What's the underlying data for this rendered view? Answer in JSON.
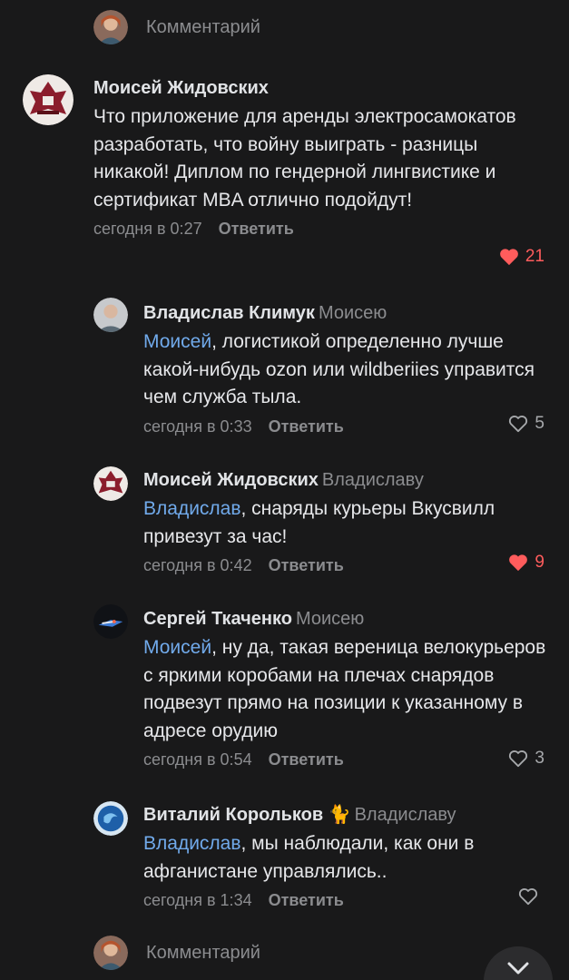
{
  "compose": {
    "placeholder": "Комментарий"
  },
  "comments": [
    {
      "author": "Моисей Жидовских",
      "reply_to": "",
      "mention": "",
      "text": "Что приложение для аренды электросамокатов разработать, что войну выиграть - разницы никакой! Диплом по гендерной лингвистике и сертификат MBA отлично подойдут!",
      "time": "сегодня в 0:27",
      "reply_label": "Ответить",
      "likes": "21",
      "liked": true
    },
    {
      "author": "Владислав Климук",
      "reply_to": "Моисею",
      "mention": "Моисей",
      "text": ", логистикой определенно лучше какой-нибудь ozon или wildberiies управится чем служба тыла.",
      "time": "сегодня в 0:33",
      "reply_label": "Ответить",
      "likes": "5",
      "liked": false
    },
    {
      "author": "Моисей Жидовских",
      "reply_to": "Владиславу",
      "mention": "Владислав",
      "text": ", снаряды курьеры Вкусвилл привезут за час!",
      "time": "сегодня в 0:42",
      "reply_label": "Ответить",
      "likes": "9",
      "liked": true
    },
    {
      "author": "Сергей Ткаченко",
      "reply_to": "Моисею",
      "mention": "Моисей",
      "text": ", ну да, такая вереница велокурьеров с яркими коробами на плечах снарядов подвезут прямо на позиции к указанному в адресе орудию",
      "time": "сегодня в 0:54",
      "reply_label": "Ответить",
      "likes": "3",
      "liked": false
    },
    {
      "author": "Виталий Корольков",
      "author_emoji": "🐈",
      "reply_to": "Владиславу",
      "mention": "Владислав",
      "text": ", мы наблюдали, как они в афганистане управлялись..",
      "time": "сегодня в 1:34",
      "reply_label": "Ответить",
      "likes": "",
      "liked": false
    }
  ],
  "colors": {
    "background": "#19191a",
    "mention": "#71aaeb",
    "like_active": "#ff5c5c",
    "secondary_text": "#8b8c8f"
  },
  "icons": [
    "heart-filled-icon",
    "heart-outline-icon",
    "chevron-down-icon"
  ]
}
